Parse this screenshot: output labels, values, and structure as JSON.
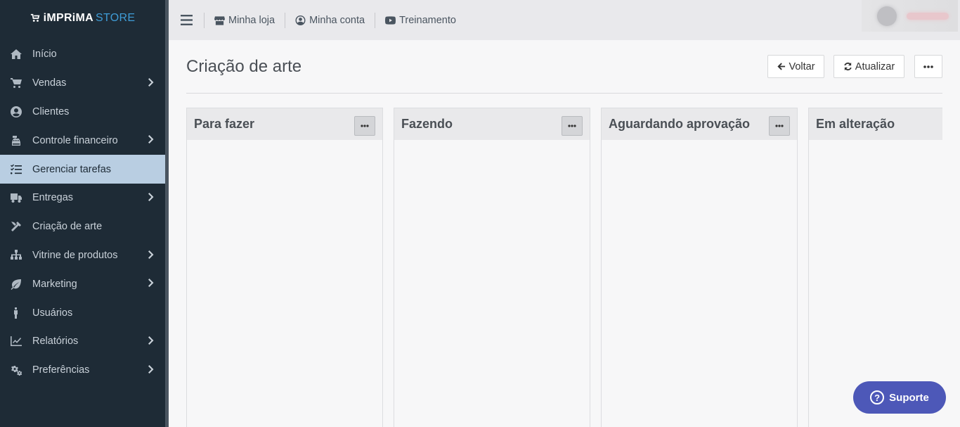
{
  "brand": {
    "part1": "iMPRiMA",
    "part2": "STORE"
  },
  "sidebar": {
    "items": [
      {
        "label": "Início",
        "icon": "home-icon",
        "has_submenu": false,
        "active": false
      },
      {
        "label": "Vendas",
        "icon": "cart-icon",
        "has_submenu": true,
        "active": false
      },
      {
        "label": "Clientes",
        "icon": "user-circle-icon",
        "has_submenu": false,
        "active": false
      },
      {
        "label": "Controle financeiro",
        "icon": "cash-register-icon",
        "has_submenu": true,
        "active": false
      },
      {
        "label": "Gerenciar tarefas",
        "icon": "tasks-icon",
        "has_submenu": false,
        "active": true
      },
      {
        "label": "Entregas",
        "icon": "truck-icon",
        "has_submenu": true,
        "active": false
      },
      {
        "label": "Criação de arte",
        "icon": "tools-icon",
        "has_submenu": false,
        "active": false
      },
      {
        "label": "Vitrine de produtos",
        "icon": "sitemap-icon",
        "has_submenu": true,
        "active": false
      },
      {
        "label": "Marketing",
        "icon": "leaf-icon",
        "has_submenu": true,
        "active": false
      },
      {
        "label": "Usuários",
        "icon": "person-icon",
        "has_submenu": false,
        "active": false
      },
      {
        "label": "Relatórios",
        "icon": "chart-line-icon",
        "has_submenu": true,
        "active": false
      },
      {
        "label": "Preferências",
        "icon": "cogs-icon",
        "has_submenu": true,
        "active": false
      }
    ]
  },
  "topbar": {
    "links": [
      {
        "label": "Minha loja",
        "icon": "store-icon"
      },
      {
        "label": "Minha conta",
        "icon": "user-circle-icon"
      },
      {
        "label": "Treinamento",
        "icon": "youtube-icon"
      }
    ]
  },
  "page": {
    "title": "Criação de arte",
    "buttons": {
      "back": "Voltar",
      "refresh": "Atualizar"
    }
  },
  "board": {
    "columns": [
      {
        "title": "Para fazer"
      },
      {
        "title": "Fazendo"
      },
      {
        "title": "Aguardando aprovação"
      },
      {
        "title": "Em alteração"
      }
    ]
  },
  "support": {
    "label": "Suporte"
  },
  "colors": {
    "sidebar_bg": "#1e2b36",
    "active_item": "#b9cee2",
    "brand_accent": "#3f9cd6",
    "support_btn": "#4d58b8"
  }
}
